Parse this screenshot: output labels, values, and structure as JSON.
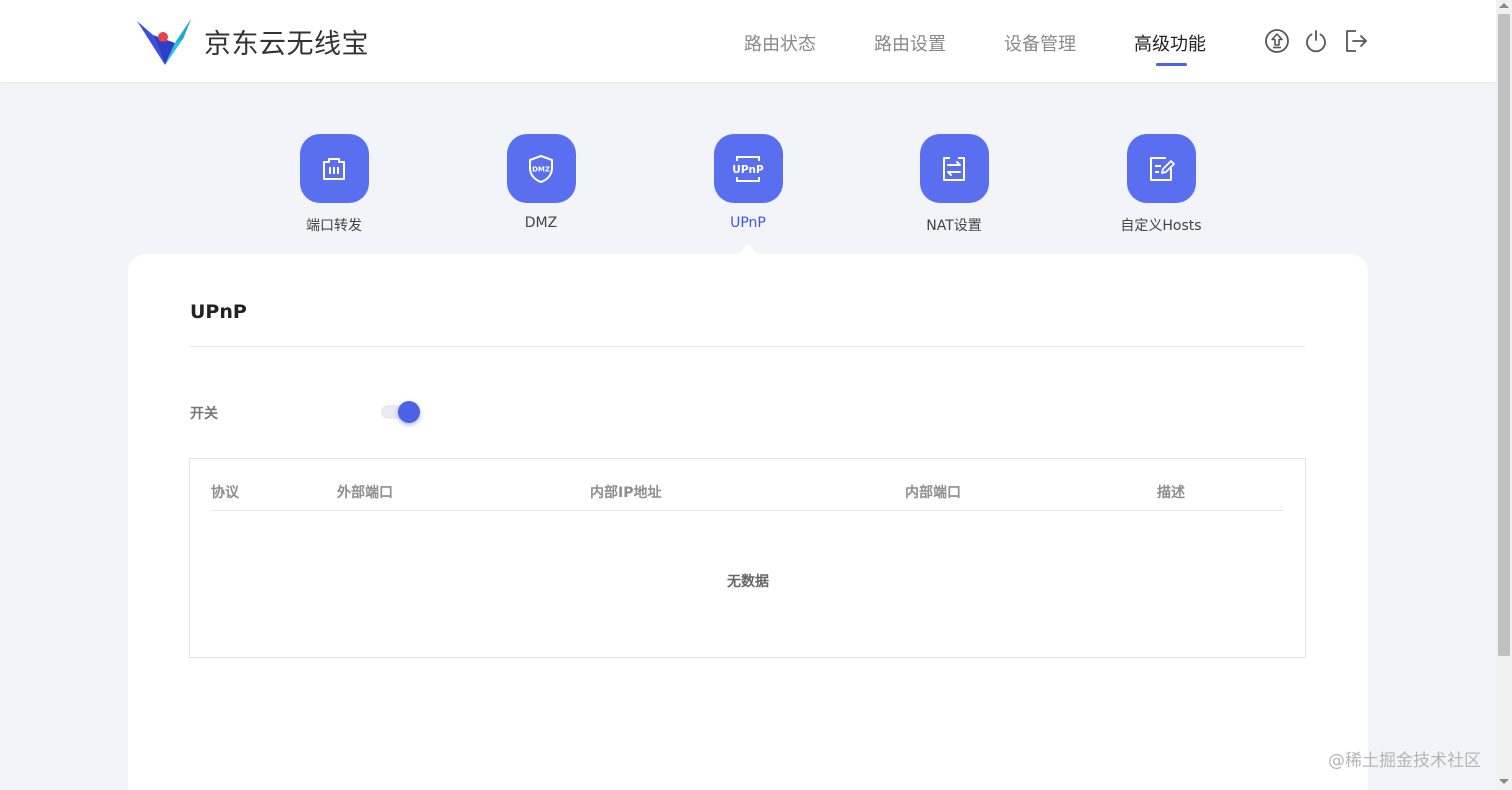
{
  "header": {
    "brand": "京东云无线宝",
    "nav": [
      {
        "label": "路由状态",
        "active": false
      },
      {
        "label": "路由设置",
        "active": false
      },
      {
        "label": "设备管理",
        "active": false
      },
      {
        "label": "高级功能",
        "active": true
      }
    ],
    "icons": [
      "upgrade-icon",
      "power-icon",
      "logout-icon"
    ]
  },
  "tiles": [
    {
      "label": "端口转发",
      "icon": "port-forward-icon",
      "active": false
    },
    {
      "label": "DMZ",
      "icon": "dmz-shield-icon",
      "active": false
    },
    {
      "label": "UPnP",
      "icon": "upnp-icon",
      "active": true
    },
    {
      "label": "NAT设置",
      "icon": "nat-icon",
      "active": false
    },
    {
      "label": "自定义Hosts",
      "icon": "hosts-edit-icon",
      "active": false
    }
  ],
  "panel": {
    "title": "UPnP",
    "switch_label": "开关",
    "switch_on": true,
    "table": {
      "columns": [
        "协议",
        "外部端口",
        "内部IP地址",
        "内部端口",
        "描述"
      ],
      "rows": [],
      "empty_text": "无数据"
    }
  },
  "watermark": "@稀土掘金技术社区",
  "colors": {
    "accent": "#4b61e6",
    "tile": "#5a6ff0",
    "background": "#f3f4f9"
  }
}
